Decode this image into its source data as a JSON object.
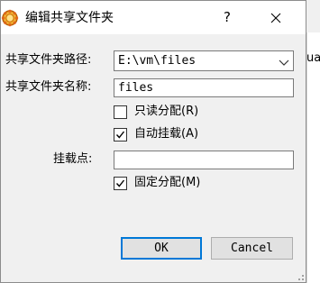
{
  "window": {
    "title": "编辑共享文件夹",
    "help_glyph": "?",
    "background_peek_text": "ual"
  },
  "form": {
    "path_label": "共享文件夹路径:",
    "path_value": "E:\\vm\\files",
    "name_label": "共享文件夹名称:",
    "name_value": "files",
    "mount_label": "挂载点:",
    "mount_value": ""
  },
  "options": {
    "readonly_label": "只读分配(R)",
    "readonly_checked": false,
    "automount_label": "自动挂载(A)",
    "automount_checked": true,
    "permanent_label": "固定分配(M)",
    "permanent_checked": true
  },
  "buttons": {
    "ok_label": "OK",
    "cancel_label": "Cancel"
  },
  "colors": {
    "dialog_bg": "#f0f0f0",
    "titlebar_bg": "#ffffff",
    "default_button_border": "#0078d7",
    "button_bg": "#e1e1e1"
  }
}
